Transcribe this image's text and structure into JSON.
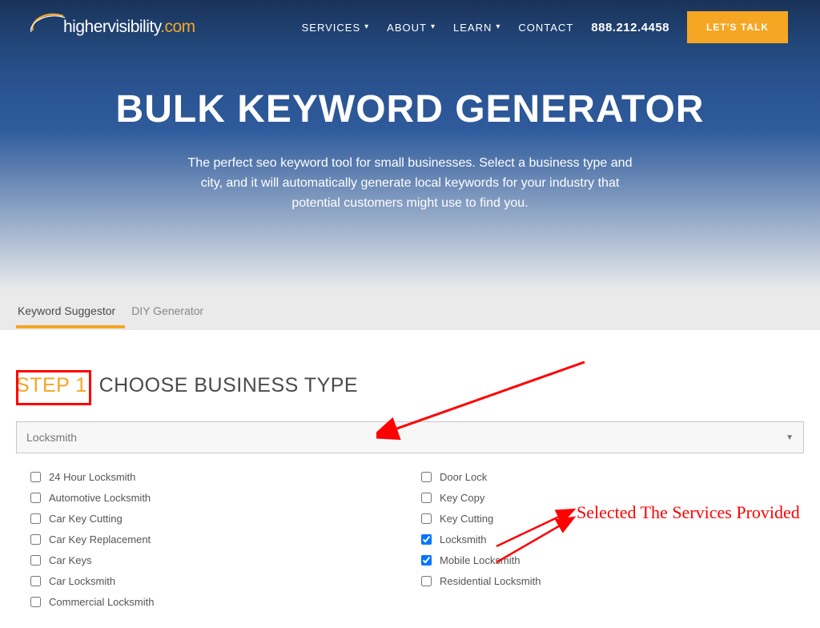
{
  "brand": {
    "name": "highervisibility",
    "tld": ".com"
  },
  "nav": {
    "items": [
      {
        "label": "SERVICES",
        "dropdown": true
      },
      {
        "label": "ABOUT",
        "dropdown": true
      },
      {
        "label": "LEARN",
        "dropdown": true
      },
      {
        "label": "CONTACT",
        "dropdown": false
      }
    ],
    "phone": "888.212.4458",
    "cta": "LET'S TALK"
  },
  "hero": {
    "title": "BULK KEYWORD GENERATOR",
    "subtitle": "The perfect seo keyword tool for small businesses. Select a business type and city, and it will automatically generate local keywords for your industry that potential customers might use to find you."
  },
  "tabs": [
    {
      "label": "Keyword Suggestor",
      "active": true
    },
    {
      "label": "DIY Generator",
      "active": false
    }
  ],
  "step": {
    "label": "STEP 1:",
    "title": " CHOOSE BUSINESS TYPE"
  },
  "business_select": {
    "selected": "Locksmith"
  },
  "services_left": [
    {
      "label": "24 Hour Locksmith",
      "checked": false
    },
    {
      "label": "Automotive Locksmith",
      "checked": false
    },
    {
      "label": "Car Key Cutting",
      "checked": false
    },
    {
      "label": "Car Key Replacement",
      "checked": false
    },
    {
      "label": "Car Keys",
      "checked": false
    },
    {
      "label": "Car Locksmith",
      "checked": false
    },
    {
      "label": "Commercial Locksmith",
      "checked": false
    }
  ],
  "services_right": [
    {
      "label": "Door Lock",
      "checked": false
    },
    {
      "label": "Key Copy",
      "checked": false
    },
    {
      "label": "Key Cutting",
      "checked": false
    },
    {
      "label": "Locksmith",
      "checked": true
    },
    {
      "label": "Mobile Locksmith",
      "checked": true
    },
    {
      "label": "Residential Locksmith",
      "checked": false
    }
  ],
  "annotations": {
    "services_note": "Selected The Services Provided"
  }
}
